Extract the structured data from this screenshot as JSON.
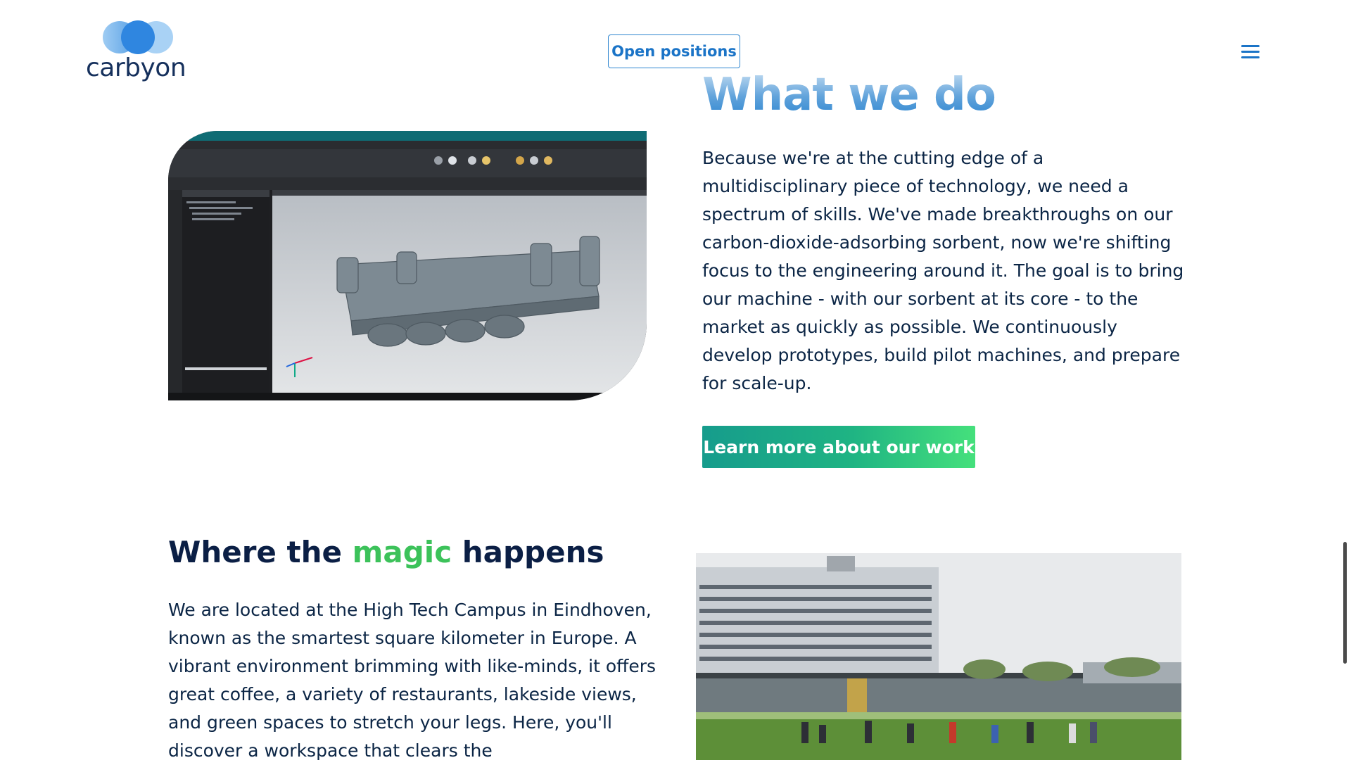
{
  "header": {
    "logo_text": "carbyon",
    "open_positions_label": "Open positions",
    "menu_icon": "hamburger-menu-icon"
  },
  "what_we_do": {
    "heading": "What we do",
    "paragraph": "Because we're at the cutting edge of a multidisciplinary piece of technology, we need a spectrum of skills. We've made breakthroughs on our carbon-dioxide-adsorbing sorbent, now we're shifting focus to the engineering around it. The goal is to bring our machine - with our sorbent at its core - to the market as quickly as possible. We continuously develop prototypes, build pilot machines, and prepare for scale-up.",
    "cta_label": "Learn more about our work"
  },
  "magic": {
    "heading_before": "Where the ",
    "heading_accent": "magic",
    "heading_after": " happens",
    "paragraph": "We are located at the High Tech Campus in Eindhoven, known as the smartest square kilometer in Europe. A vibrant environment brimming with like-minds, it offers great coffee, a variety of restaurants, lakeside views, and green spaces to stretch your legs. Here, you'll discover a workspace that clears the"
  },
  "colors": {
    "brand_blue": "#1b74c7",
    "navy": "#0b2545",
    "accent_green": "#3cc25a",
    "cta_gradient_start": "#169c8c",
    "cta_gradient_end": "#45e07c"
  }
}
